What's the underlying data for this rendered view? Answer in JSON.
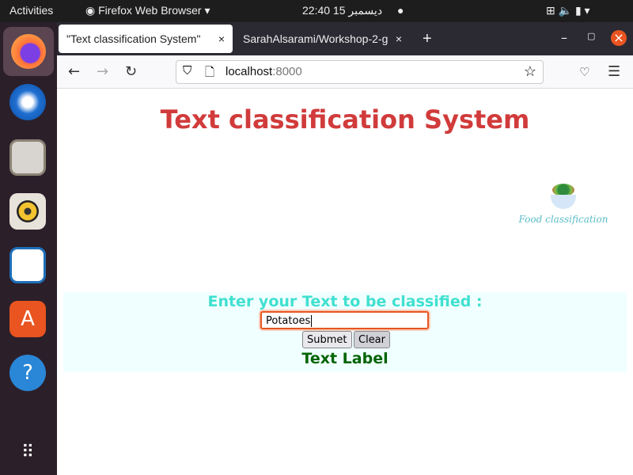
{
  "topbar": {
    "activities": "Activities",
    "app": "Firefox Web Browser ▾",
    "clock": "22:40  15 ديسمبر",
    "indicators": "⊞  🔈  ▮  ▾"
  },
  "dock": {
    "items": [
      "firefox",
      "thunderbird",
      "files",
      "rhythmbox",
      "libreoffice-writer",
      "software",
      "help",
      "apps-grid"
    ]
  },
  "tabs": [
    {
      "label": "\"Text classification System\"",
      "active": true
    },
    {
      "label": "SarahAlsarami/Workshop-2-g",
      "active": false
    }
  ],
  "tab_close": "×",
  "new_tab": "+",
  "window": {
    "minimize": "–",
    "maximize": "▢",
    "close": "×"
  },
  "nav": {
    "url_host": "localhost",
    "url_port": ":8000"
  },
  "page": {
    "title": "Text classification System",
    "logo_text": "Food classification",
    "prompt": "Enter your Text to be classified :",
    "input_value": "Potatoes",
    "submit": "Submet",
    "clear": "Clear",
    "result": "Text Label"
  },
  "colors": {
    "title": "#d13b3b",
    "prompt": "#40e0d0",
    "result": "#006400",
    "panel": "#f0ffff",
    "accent": "#e95420"
  }
}
